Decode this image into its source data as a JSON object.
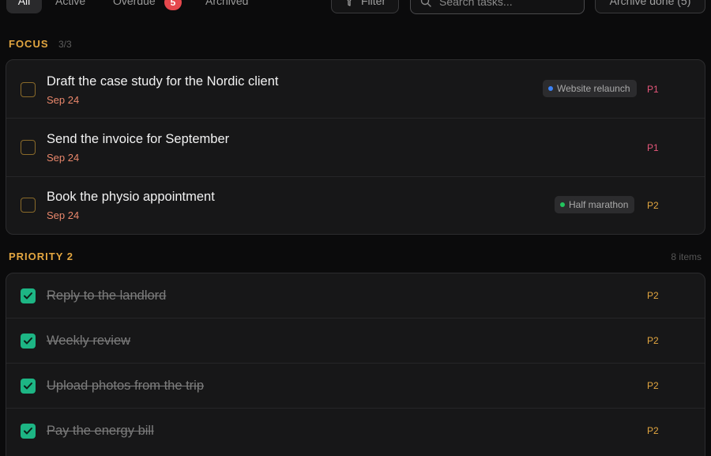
{
  "toolbar": {
    "tabs": [
      {
        "label": "All",
        "active": true
      },
      {
        "label": "Active"
      },
      {
        "label": "Overdue",
        "badge": "5"
      },
      {
        "label": "Archived"
      }
    ],
    "filter_label": "Filter",
    "search_placeholder": "Search tasks...",
    "search_value": "",
    "archive_label": "Archive done (5)"
  },
  "focus": {
    "title": "FOCUS",
    "count": "3/3",
    "tasks": [
      {
        "title": "Draft the case study for the Nordic client",
        "date": "Sep 24",
        "tag": "Website relaunch",
        "tag_color": "#3b82f6",
        "priority": "P1",
        "done": false
      },
      {
        "title": "Send the invoice for September",
        "date": "Sep 24",
        "priority": "P1",
        "done": false
      },
      {
        "title": "Book the physio appointment",
        "date": "Sep 24",
        "tag": "Half marathon",
        "tag_color": "#22c55e",
        "priority": "P2",
        "done": false
      }
    ]
  },
  "priority2": {
    "title": "PRIORITY 2",
    "count": "8 items",
    "tasks": [
      {
        "title": "Reply to the landlord",
        "priority": "P2",
        "done": true
      },
      {
        "title": "Weekly review",
        "priority": "P2",
        "done": true
      },
      {
        "title": "Upload photos from the trip",
        "priority": "P2",
        "done": true
      },
      {
        "title": "Pay the energy bill",
        "priority": "P2",
        "done": true
      }
    ]
  },
  "colors": {
    "accent": "#e3a640",
    "done_check": "#1db584",
    "p1": "#e5567a",
    "p2": "#e3a640",
    "date": "#e9876b",
    "badge": "#e5484d"
  }
}
